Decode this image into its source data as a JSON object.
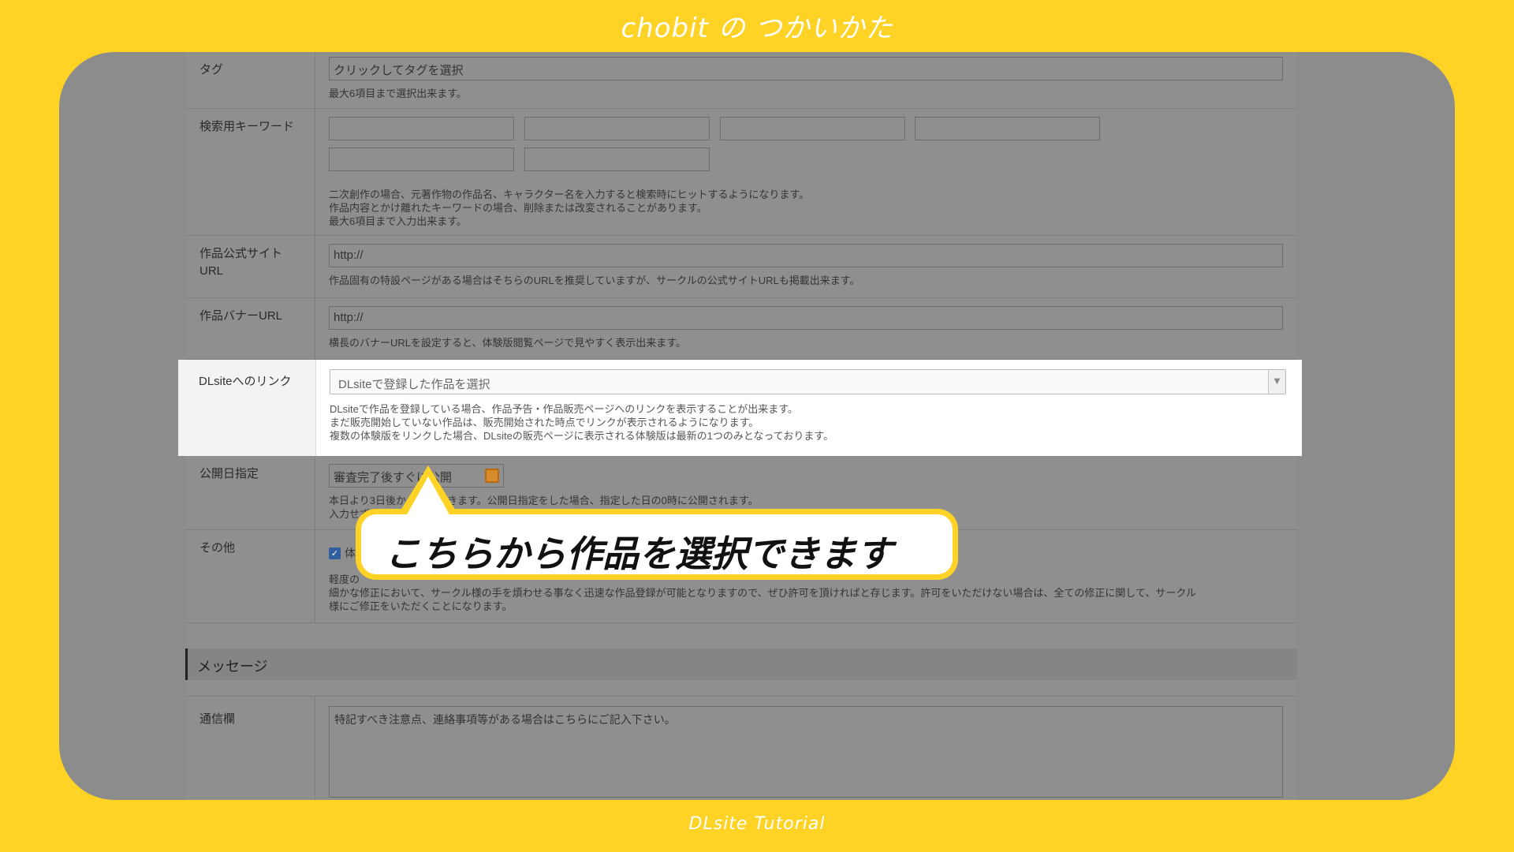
{
  "header": {
    "title": "chobit の つかいかた"
  },
  "footer": {
    "title": "DLsite Tutorial"
  },
  "form": {
    "tag": {
      "label": "タグ",
      "placeholder": "クリックしてタグを選択",
      "help": "最大6項目まで選択出来ます。"
    },
    "keywords": {
      "label": "検索用キーワード",
      "help": [
        "二次創作の場合、元著作物の作品名、キャラクター名を入力すると検索時にヒットするようになります。",
        "作品内容とかけ離れたキーワードの場合、削除または改変されることがあります。",
        "最大6項目まで入力出来ます。"
      ]
    },
    "official_site": {
      "label_line1": "作品公式サイト",
      "label_line2": "URL",
      "value": "http://",
      "help": "作品固有の特設ページがある場合はそちらのURLを推奨していますが、サークルの公式サイトURLも掲載出来ます。"
    },
    "banner_url": {
      "label": "作品バナーURL",
      "value": "http://",
      "help": "横長のバナーURLを設定すると、体験版閲覧ページで見やすく表示出来ます。"
    },
    "dlsite_link": {
      "label": "DLsiteへのリンク",
      "select_value": "DLsiteで登録した作品を選択",
      "help": [
        "DLsiteで作品を登録している場合、作品予告・作品販売ページへのリンクを表示することが出来ます。",
        "まだ販売開始していない作品は、販売開始された時点でリンクが表示されるようになります。",
        "複数の体験版をリンクした場合、DLsiteの販売ページに表示される体験版は最新の1つのみとなっております。"
      ]
    },
    "publish_date": {
      "label": "公開日指定",
      "value": "審査完了後すぐに公開",
      "help_line1": "本日より3日後から選択できます。公開日指定をした場合、指定した日の0時に公開されます。",
      "help_line2": "入力せず"
    },
    "other": {
      "label": "その他",
      "checkbox_label": "体",
      "help_line1": "軽度の",
      "help_line2": "細かな修正において、サークル様の手を煩わせる事なく迅速な作品登録が可能となりますので、ぜひ許可を頂ければと存じます。許可をいただけない場合は、全ての修正に関して、サークル",
      "help_line3": "様にご修正をいただくことになります。"
    },
    "message_section": {
      "title": "メッセージ"
    },
    "message": {
      "label": "通信欄",
      "placeholder": "特記すべき注意点、連絡事項等がある場合はこちらにご記入下さい。"
    }
  },
  "callout": {
    "text": "こちらから作品を選択できます"
  }
}
